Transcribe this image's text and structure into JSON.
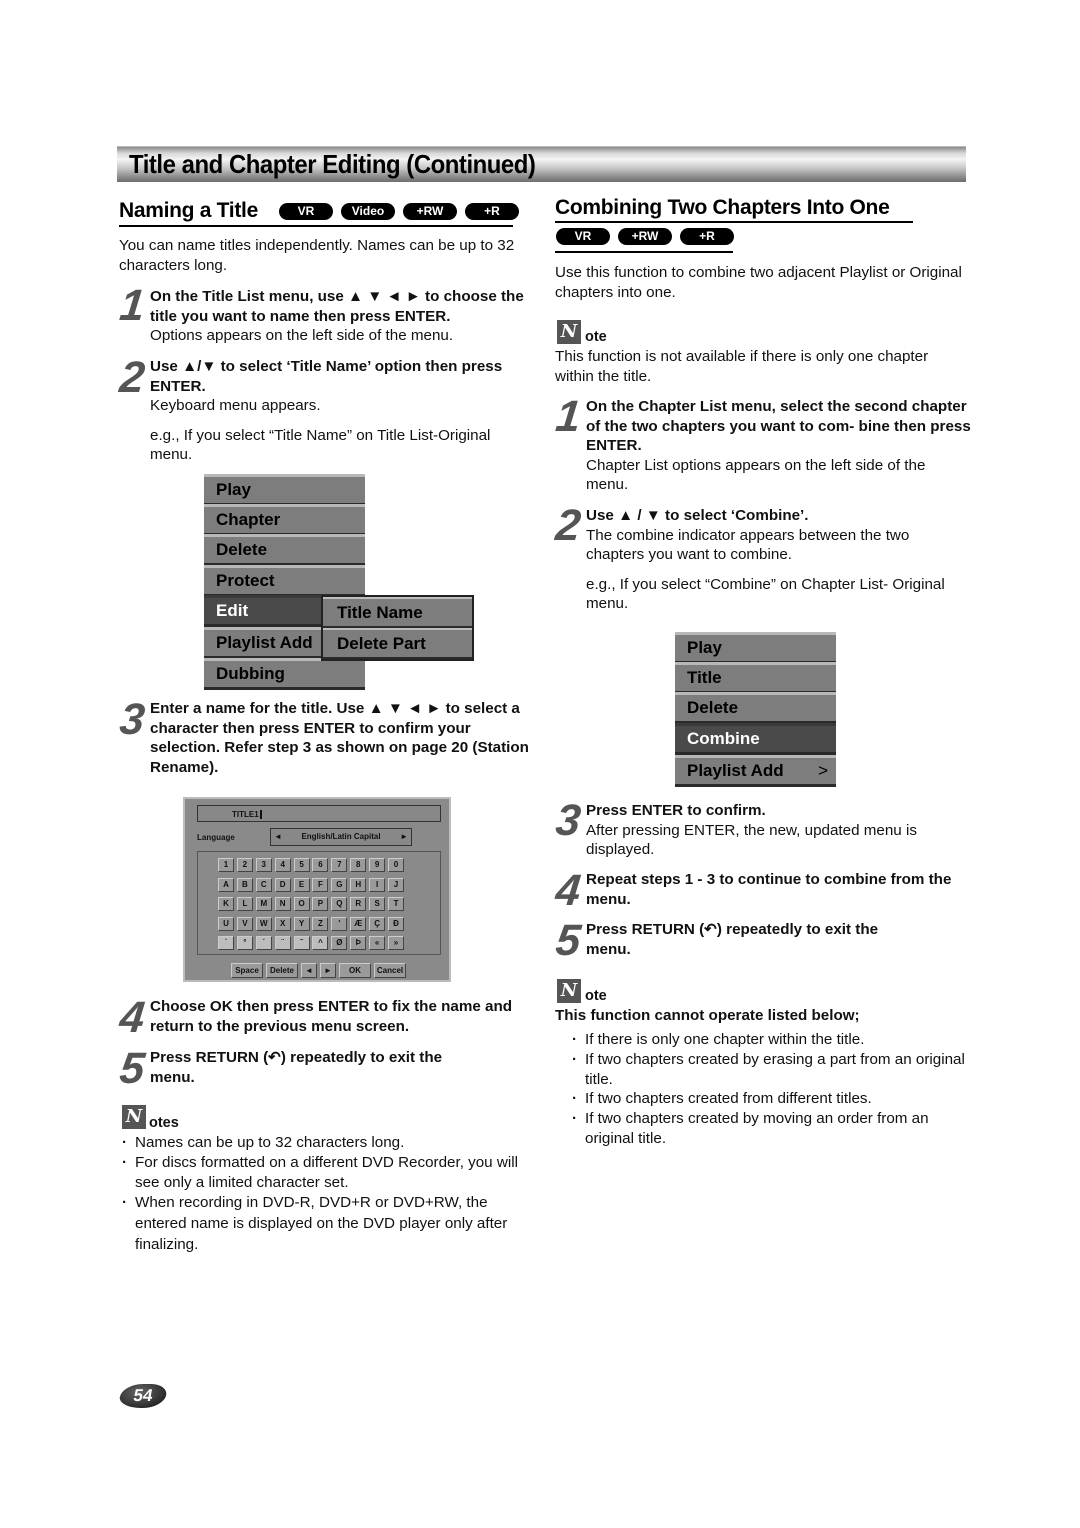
{
  "header": {
    "title": "Title and Chapter Editing (Continued)"
  },
  "left": {
    "section_title": "Naming a Title",
    "badges": [
      "VR",
      "Video",
      "+RW",
      "+R"
    ],
    "intro": "You can name titles independently. Names can be up to 32 characters long.",
    "steps": [
      {
        "num": "1",
        "bold": "On the Title List menu, use ▲ ▼ ◄ ► to choose the title you want to name then press ENTER.",
        "text": "Options appears on the left side of the menu."
      },
      {
        "num": "2",
        "bold": "Use ▲/▼ to select ‘Title Name’ option then press ENTER.",
        "text": "Keyboard menu appears.",
        "example": "e.g., If you select “Title Name” on Title List-Original menu."
      },
      {
        "num": "3",
        "bold": "Enter a name for the title. Use ▲ ▼ ◄ ► to select a character then press ENTER to confirm your selection. Refer step 3 as shown on page 20 (Station Rename)."
      },
      {
        "num": "4",
        "bold": "Choose OK then press ENTER to fix the name and return to the previous menu screen."
      },
      {
        "num": "5",
        "bold": "Press RETURN (↶) repeatedly to exit the menu."
      }
    ],
    "menu": {
      "items": [
        "Play",
        "Chapter",
        "Delete",
        "Protect",
        "Edit",
        "Playlist Add",
        "Dubbing"
      ],
      "selected": "Edit",
      "submenu": [
        "Title Name",
        "Delete Part"
      ]
    },
    "keyboard": {
      "title_value": "TITLE1",
      "language_label": "Language",
      "language_value": "English/Latin Capital",
      "rows": [
        [
          "1",
          "2",
          "3",
          "4",
          "5",
          "6",
          "7",
          "8",
          "9",
          "0"
        ],
        [
          "A",
          "B",
          "C",
          "D",
          "E",
          "F",
          "G",
          "H",
          "I",
          "J"
        ],
        [
          "K",
          "L",
          "M",
          "N",
          "O",
          "P",
          "Q",
          "R",
          "S",
          "T"
        ],
        [
          "U",
          "V",
          "W",
          "X",
          "Y",
          "Z",
          "'",
          "Æ",
          "Ç",
          "Ð"
        ],
        [
          "`",
          "°",
          "´",
          "¨",
          "˜",
          "^",
          "Ø",
          "Þ",
          "«",
          "»"
        ]
      ],
      "buttons": [
        "Space",
        "Delete",
        "◄",
        "►",
        "OK",
        "Cancel"
      ]
    },
    "notes_label": "otes",
    "notes": [
      "Names can be up to 32 characters long.",
      "For discs formatted on a different DVD Recorder, you will see only a limited character set.",
      "When recording in DVD-R, DVD+R or DVD+RW, the entered name is displayed on the DVD player only after finalizing."
    ]
  },
  "right": {
    "section_title": "Combining Two Chapters Into One",
    "badges": [
      "VR",
      "+RW",
      "+R"
    ],
    "intro": "Use this function to combine two adjacent Playlist or Original chapters into one.",
    "note1_label": "ote",
    "note1_text": "This function is not available if there is only one chapter within the title.",
    "steps": [
      {
        "num": "1",
        "bold": "On the Chapter List menu, select the second chapter of the two chapters you want to com- bine then press ENTER.",
        "text": "Chapter List options appears on the left side of the menu."
      },
      {
        "num": "2",
        "bold": "Use ▲ / ▼ to select ‘Combine’.",
        "text": "The combine indicator appears between the two chapters you want to combine.",
        "example": "e.g., If you select “Combine” on Chapter List- Original menu."
      },
      {
        "num": "3",
        "bold": "Press ENTER to confirm.",
        "text": "After pressing ENTER, the new, updated menu is displayed."
      },
      {
        "num": "4",
        "bold": "Repeat steps 1 - 3 to continue to combine from the menu."
      },
      {
        "num": "5",
        "bold": "Press RETURN (↶) repeatedly to exit the menu."
      }
    ],
    "menu": {
      "items": [
        "Play",
        "Title",
        "Delete",
        "Combine",
        "Playlist Add"
      ],
      "selected": "Combine",
      "arrow": ">"
    },
    "note2_label": "ote",
    "note2_heading": "This function cannot operate listed below;",
    "note2_items": [
      "If there is only one chapter within the title.",
      "If two chapters created by erasing a part from an original title.",
      "If two chapters created from different titles.",
      "If two chapters created by moving an order from an original title."
    ]
  },
  "footer": {
    "page_number": "54"
  }
}
